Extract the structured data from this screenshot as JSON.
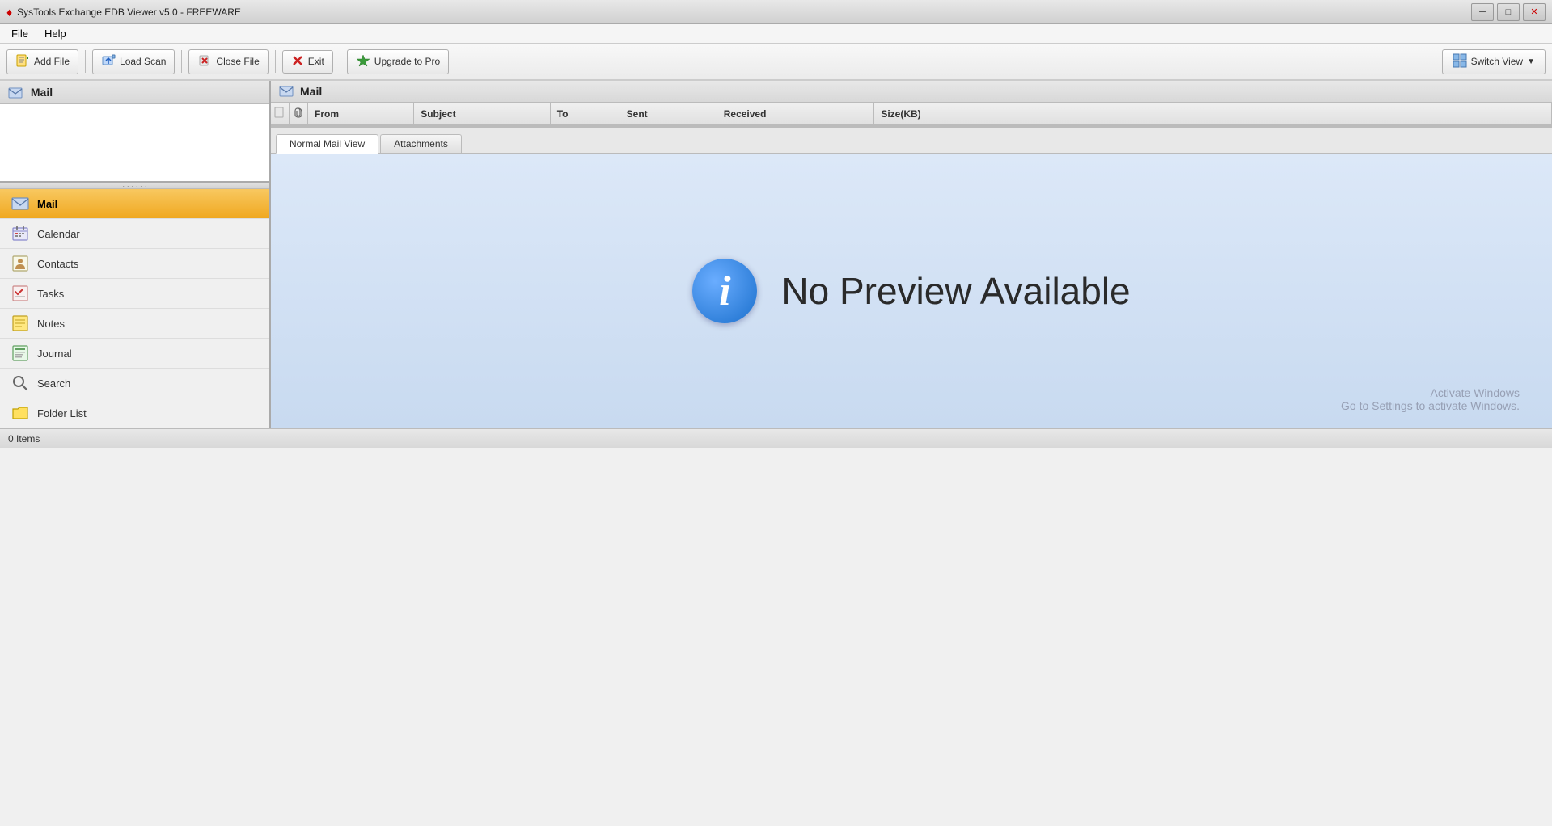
{
  "window": {
    "title": "SysTools Exchange EDB Viewer v5.0 - FREEWARE",
    "logo": "♦"
  },
  "titlebar_controls": {
    "minimize": "─",
    "maximize": "□",
    "close": "✕"
  },
  "menu": {
    "items": [
      {
        "id": "file",
        "label": "File"
      },
      {
        "id": "help",
        "label": "Help"
      }
    ]
  },
  "toolbar": {
    "add_file_label": "Add File",
    "load_scan_label": "Load Scan",
    "close_file_label": "Close File",
    "exit_label": "Exit",
    "upgrade_label": "Upgrade to Pro",
    "switch_view_label": "Switch View"
  },
  "sidebar": {
    "header_label": "Mail",
    "resize_dots": "· · · · · ·",
    "nav_items": [
      {
        "id": "mail",
        "label": "Mail",
        "icon": "mail"
      },
      {
        "id": "calendar",
        "label": "Calendar",
        "icon": "calendar"
      },
      {
        "id": "contacts",
        "label": "Contacts",
        "icon": "contacts"
      },
      {
        "id": "tasks",
        "label": "Tasks",
        "icon": "tasks"
      },
      {
        "id": "notes",
        "label": "Notes",
        "icon": "notes"
      },
      {
        "id": "journal",
        "label": "Journal",
        "icon": "journal"
      },
      {
        "id": "search",
        "label": "Search",
        "icon": "search"
      },
      {
        "id": "folder-list",
        "label": "Folder List",
        "icon": "folder-list"
      }
    ]
  },
  "mail_list": {
    "header_label": "Mail",
    "columns": [
      {
        "id": "flag",
        "label": ""
      },
      {
        "id": "attach",
        "label": "🖇"
      },
      {
        "id": "from",
        "label": "From"
      },
      {
        "id": "subject",
        "label": "Subject"
      },
      {
        "id": "to",
        "label": "To"
      },
      {
        "id": "sent",
        "label": "Sent"
      },
      {
        "id": "received",
        "label": "Received"
      },
      {
        "id": "size",
        "label": "Size(KB)"
      }
    ]
  },
  "preview": {
    "tabs": [
      {
        "id": "normal-mail-view",
        "label": "Normal Mail View",
        "active": true
      },
      {
        "id": "attachments",
        "label": "Attachments",
        "active": false
      }
    ],
    "no_preview_text": "No Preview Available",
    "info_icon_text": "i",
    "activate_line1": "Activate Windows",
    "activate_line2": "Go to Settings to activate Windows."
  },
  "status_bar": {
    "items_label": "0 Items"
  }
}
